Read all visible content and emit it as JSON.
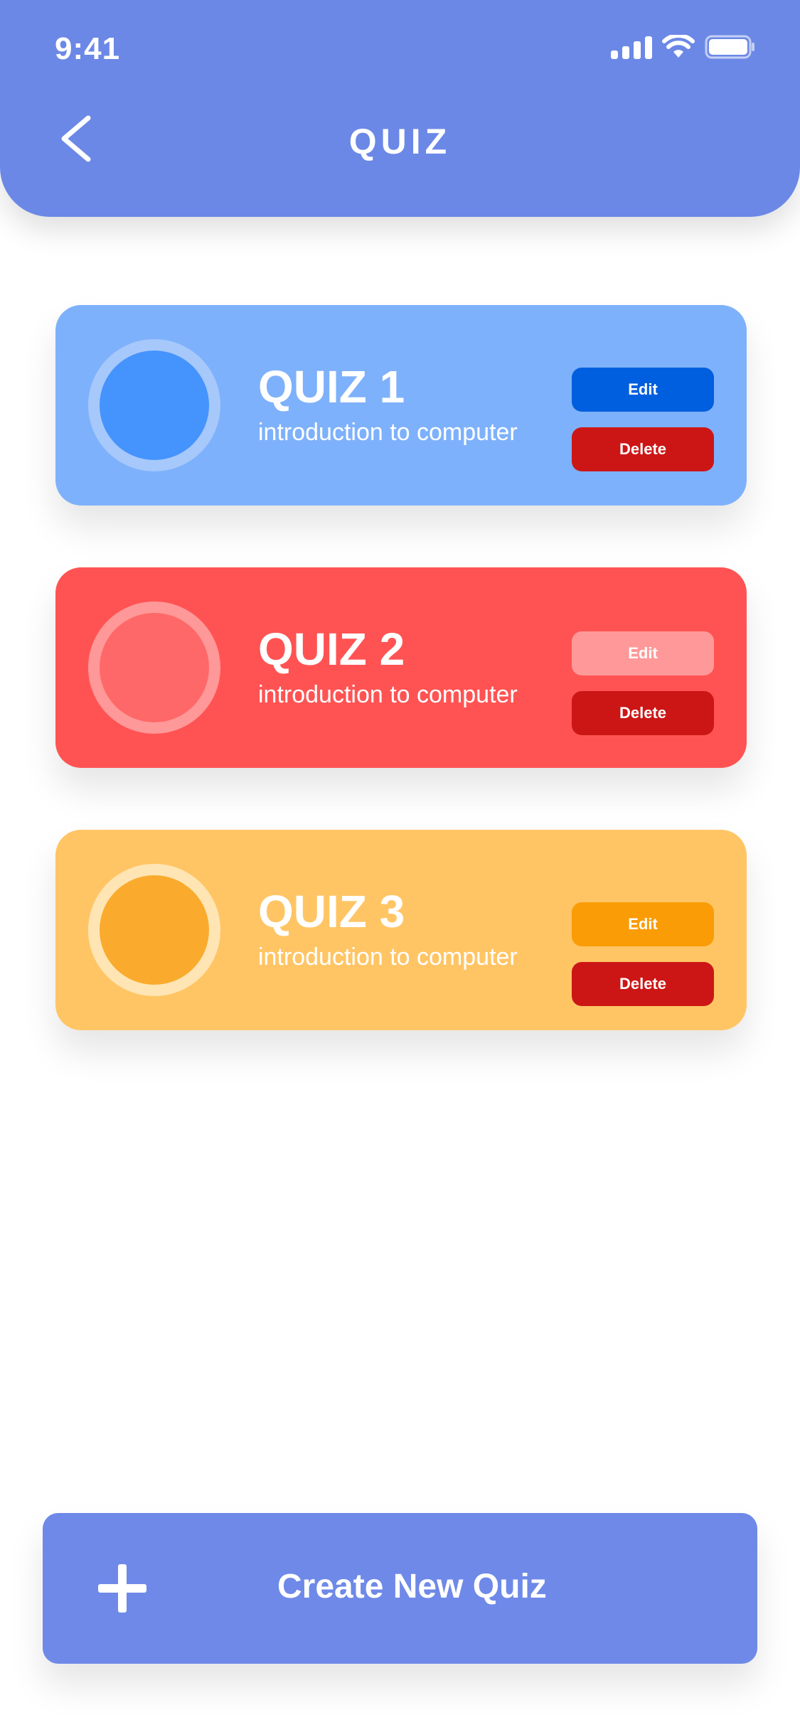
{
  "status_bar": {
    "time": "9:41"
  },
  "header": {
    "title": "QUIZ"
  },
  "quizzes": [
    {
      "title": "QUIZ 1",
      "subtitle": "introduction to computer",
      "edit_label": "Edit",
      "delete_label": "Delete"
    },
    {
      "title": "QUIZ 2",
      "subtitle": "introduction to computer",
      "edit_label": "Edit",
      "delete_label": "Delete"
    },
    {
      "title": "QUIZ 3",
      "subtitle": "introduction to computer",
      "edit_label": "Edit",
      "delete_label": "Delete"
    }
  ],
  "create_button": {
    "label": "Create New Quiz"
  },
  "colors": {
    "header": "#6b88e6",
    "quiz1": "#7eb1fb",
    "quiz2": "#ff5353",
    "quiz3": "#ffc565",
    "delete": "#cc1616"
  },
  "icons": [
    "signal-icon",
    "wifi-icon",
    "battery-icon",
    "back-arrow-icon",
    "plus-icon"
  ]
}
